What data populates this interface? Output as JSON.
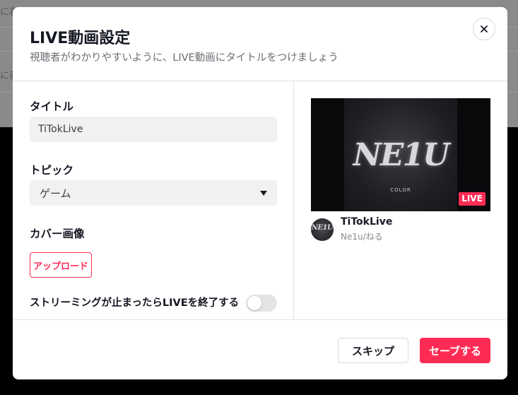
{
  "background": {
    "partial_texts": [
      "に表",
      "に表"
    ]
  },
  "modal": {
    "title": "LIVE動画設定",
    "subtitle": "視聴者がわかりやすいように、LIVE動画にタイトルをつけましょう",
    "close_icon": "close-icon"
  },
  "form": {
    "title_label": "タイトル",
    "title_value": "TiTokLive",
    "topic_label": "トピック",
    "topic_value": "ゲーム",
    "cover_label": "カバー画像",
    "upload_label": "アップロード",
    "end_on_stop_label": "ストリーミングが止まったらLIVEを終了する",
    "end_on_stop_enabled": false
  },
  "preview": {
    "cover_text": "NE1U",
    "cover_subtext": "COLOR",
    "live_badge": "LIVE",
    "title": "TiTokLive",
    "author": "Ne1u/ねる",
    "avatar_text": "NE1U"
  },
  "footer": {
    "skip_label": "スキップ",
    "save_label": "セーブする"
  },
  "colors": {
    "accent": "#fe2c55",
    "text_primary": "#161823",
    "text_secondary": "#6b6d74",
    "input_bg": "#f1f1f2"
  }
}
